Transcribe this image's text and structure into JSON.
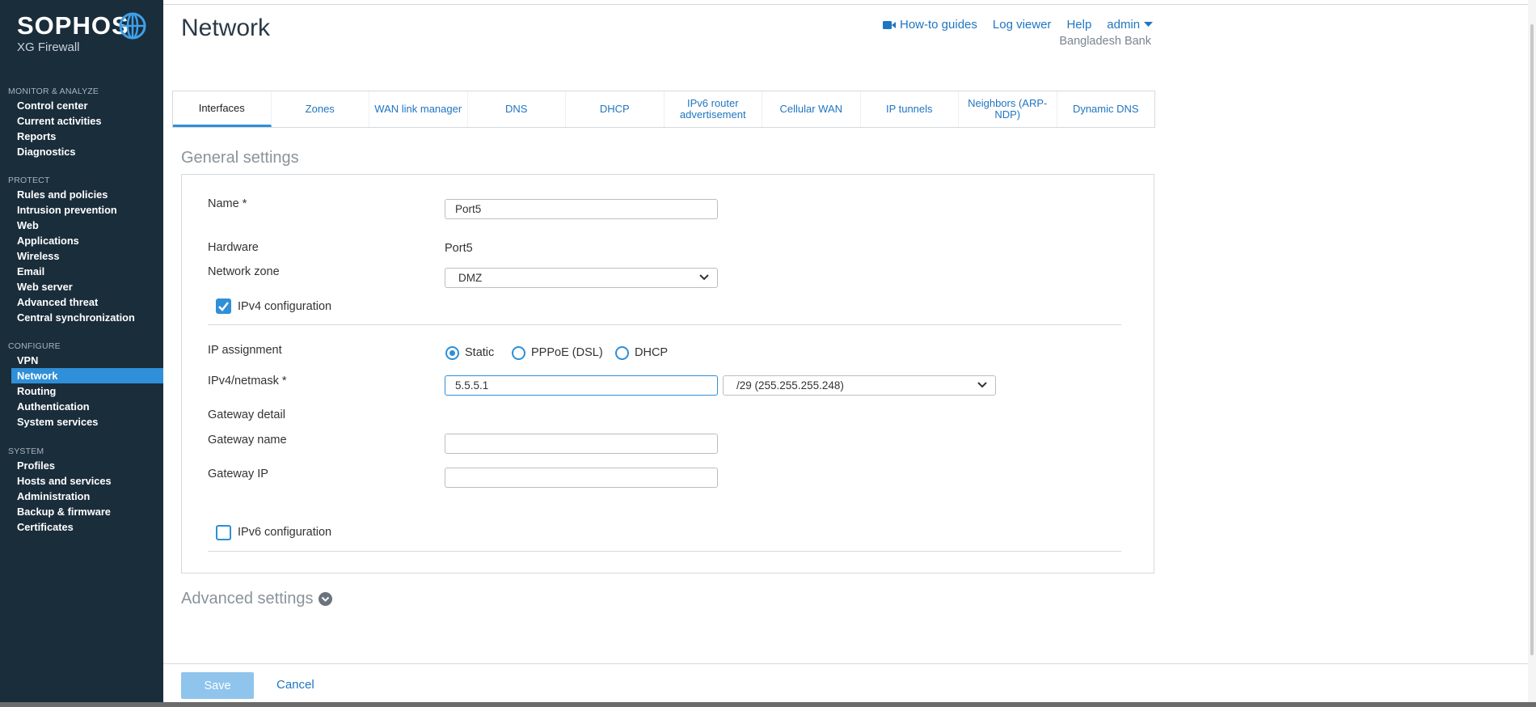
{
  "brand": {
    "logo": "SOPHOS",
    "product": "XG Firewall"
  },
  "sidebar": {
    "sections": [
      {
        "heading": "MONITOR & ANALYZE",
        "items": [
          "Control center",
          "Current activities",
          "Reports",
          "Diagnostics"
        ]
      },
      {
        "heading": "PROTECT",
        "items": [
          "Rules and policies",
          "Intrusion prevention",
          "Web",
          "Applications",
          "Wireless",
          "Email",
          "Web server",
          "Advanced threat",
          "Central synchronization"
        ]
      },
      {
        "heading": "CONFIGURE",
        "items": [
          "VPN",
          "Network",
          "Routing",
          "Authentication",
          "System services"
        ]
      },
      {
        "heading": "SYSTEM",
        "items": [
          "Profiles",
          "Hosts and services",
          "Administration",
          "Backup & firmware",
          "Certificates"
        ]
      }
    ],
    "active_item": "Network"
  },
  "header": {
    "title": "Network",
    "links": {
      "guides": "How-to guides",
      "log_viewer": "Log viewer",
      "help": "Help",
      "user": "admin"
    },
    "org": "Bangladesh Bank"
  },
  "tabs": [
    "Interfaces",
    "Zones",
    "WAN link manager",
    "DNS",
    "DHCP",
    "IPv6 router advertisement",
    "Cellular WAN",
    "IP tunnels",
    "Neighbors (ARP-NDP)",
    "Dynamic DNS"
  ],
  "active_tab": "Interfaces",
  "general": {
    "title": "General settings",
    "name_label": "Name *",
    "name_value": "Port5",
    "hardware_label": "Hardware",
    "hardware_value": "Port5",
    "zone_label": "Network zone",
    "zone_value": "DMZ",
    "ipv4_label": "IPv4 configuration",
    "ipv4_checked": true,
    "ip_assignment_label": "IP assignment",
    "ip_options": [
      "Static",
      "PPPoE (DSL)",
      "DHCP"
    ],
    "ip_selected": "Static",
    "ipv4_label_netmask": "IPv4/netmask *",
    "ipv4_value": "5.5.5.1",
    "netmask_value": "/29 (255.255.255.248)",
    "gateway_detail_label": "Gateway detail",
    "gateway_name_label": "Gateway name",
    "gateway_name_value": "",
    "gateway_ip_label": "Gateway IP",
    "gateway_ip_value": "",
    "ipv6_label": "IPv6 configuration",
    "ipv6_checked": false
  },
  "advanced": {
    "title": "Advanced settings"
  },
  "footer": {
    "save": "Save",
    "cancel": "Cancel"
  },
  "colors": {
    "sidebar_bg": "#1a2d3b",
    "accent": "#2f8fd8",
    "link": "#1f75c2",
    "save_disabled": "#8fc4ec"
  }
}
